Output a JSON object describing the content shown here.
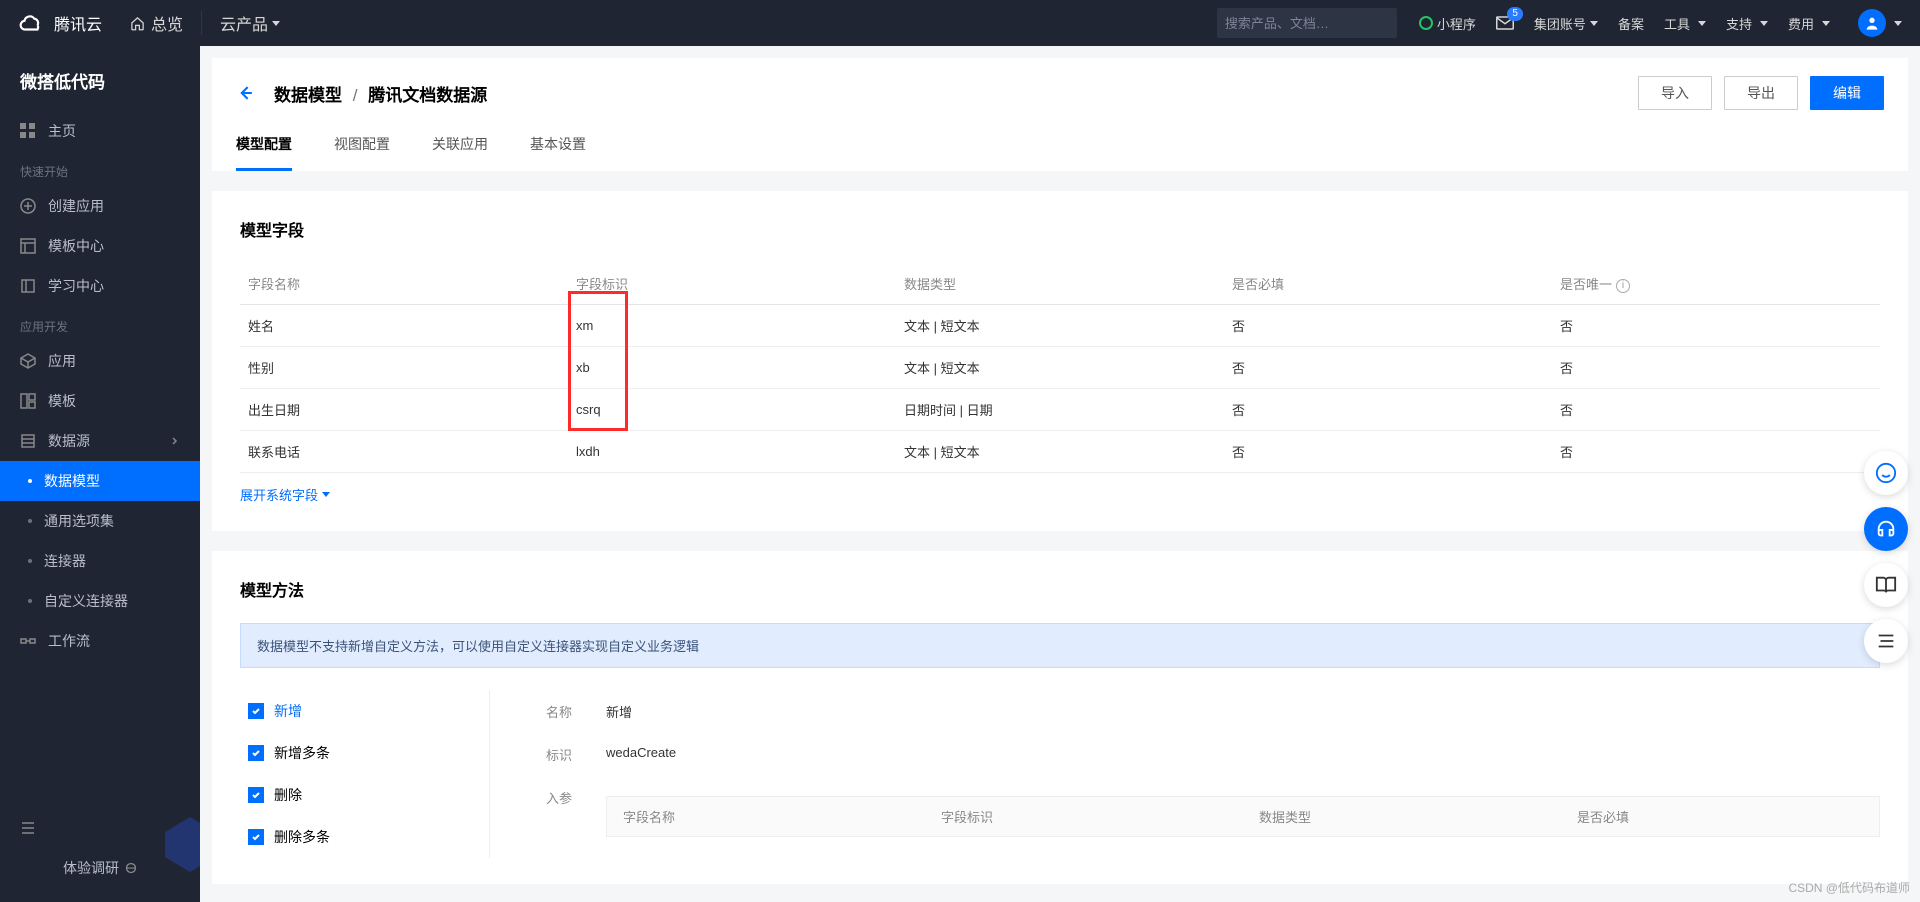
{
  "topbar": {
    "brand": "腾讯云",
    "overview": "总览",
    "products": "云产品",
    "search_placeholder": "搜索产品、文档…",
    "miniapp": "小程序",
    "mail_badge": "5",
    "account": "集团账号",
    "links": [
      "备案",
      "工具",
      "支持",
      "费用"
    ]
  },
  "sidebar": {
    "title": "微搭低代码",
    "home": "主页",
    "sections": {
      "quickstart": "快速开始",
      "appdev": "应用开发"
    },
    "items": {
      "create_app": "创建应用",
      "template_center": "模板中心",
      "learning": "学习中心",
      "apps": "应用",
      "templates": "模板",
      "datasource": "数据源",
      "workflows": "工作流"
    },
    "subs": {
      "data_model": "数据模型",
      "option_set": "通用选项集",
      "connector": "连接器",
      "custom_connector": "自定义连接器"
    },
    "bottom": "体验调研"
  },
  "page": {
    "back_icon": "back",
    "crumb_root": "数据模型",
    "crumb_leaf": "腾讯文档数据源",
    "actions": {
      "import": "导入",
      "export": "导出",
      "edit": "编辑"
    },
    "tabs": [
      "模型配置",
      "视图配置",
      "关联应用",
      "基本设置"
    ]
  },
  "fields_card": {
    "title": "模型字段",
    "headers": [
      "字段名称",
      "字段标识",
      "数据类型",
      "是否必填",
      "是否唯一"
    ],
    "rows": [
      {
        "name": "姓名",
        "id": "xm",
        "type": "文本 | 短文本",
        "required": "否",
        "unique": "否"
      },
      {
        "name": "性别",
        "id": "xb",
        "type": "文本 | 短文本",
        "required": "否",
        "unique": "否"
      },
      {
        "name": "出生日期",
        "id": "csrq",
        "type": "日期时间 | 日期",
        "required": "否",
        "unique": "否"
      },
      {
        "name": "联系电话",
        "id": "lxdh",
        "type": "文本 | 短文本",
        "required": "否",
        "unique": "否"
      }
    ],
    "expand": "展开系统字段"
  },
  "methods_card": {
    "title": "模型方法",
    "alert": "数据模型不支持新增自定义方法，可以使用自定义连接器实现自定义业务逻辑",
    "nav": [
      "新增",
      "新增多条",
      "删除",
      "删除多条"
    ],
    "form": {
      "name_label": "名称",
      "name_value": "新增",
      "id_label": "标识",
      "id_value": "wedaCreate",
      "params_label": "入参",
      "param_headers": [
        "字段名称",
        "字段标识",
        "数据类型",
        "是否必填"
      ]
    }
  },
  "watermark": "CSDN @低代码布道师"
}
